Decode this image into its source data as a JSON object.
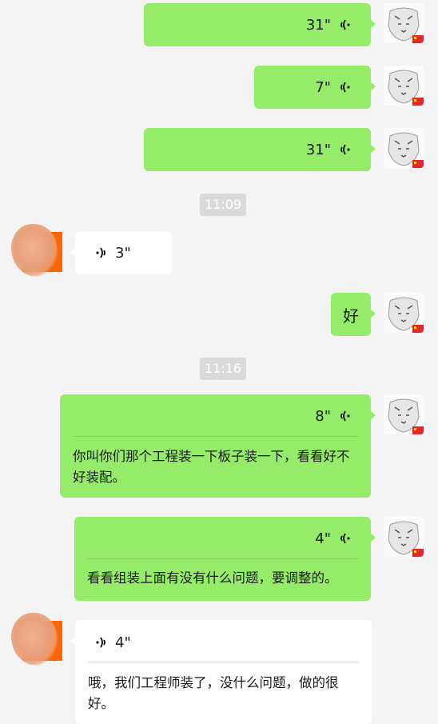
{
  "messages": [
    {
      "sender": "self",
      "type": "voice",
      "duration": "31\""
    },
    {
      "sender": "self",
      "type": "voice",
      "duration": "7\""
    },
    {
      "sender": "self",
      "type": "voice",
      "duration": "31\""
    },
    {
      "type": "time",
      "text": "11:09"
    },
    {
      "sender": "other",
      "type": "voice",
      "duration": "3\""
    },
    {
      "sender": "self",
      "type": "text",
      "text": "好"
    },
    {
      "type": "time",
      "text": "11:16"
    },
    {
      "sender": "self",
      "type": "voice",
      "duration": "8\"",
      "transcript": "你叫你们那个工程装一下板子装一下，看看好不好装配。"
    },
    {
      "sender": "self",
      "type": "voice",
      "duration": "4\"",
      "transcript": "看看组装上面有没有什么问题，要调整的。"
    },
    {
      "sender": "other",
      "type": "voice",
      "duration": "4\"",
      "transcript": "哦，我们工程师装了，没什么问题，做的很好。"
    }
  ],
  "colors": {
    "self_bubble": "#95ec69",
    "other_bubble": "#ffffff",
    "background": "#f4f4f5",
    "time_badge": "#dadada"
  },
  "icons": {
    "voice": "voice-wave-icon",
    "self_avatar": "tiger-avatar",
    "flag": "china-flag-icon"
  }
}
